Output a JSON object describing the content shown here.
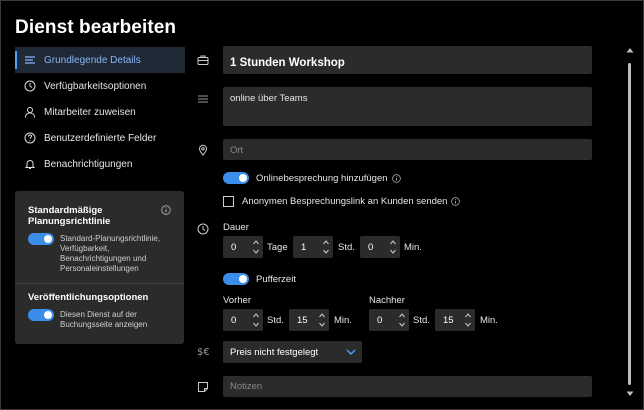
{
  "window": {
    "title": "Dienst bearbeiten"
  },
  "nav": {
    "items": [
      {
        "label": "Grundlegende Details",
        "active": true,
        "icon": "list-icon"
      },
      {
        "label": "Verfügbarkeitsoptionen",
        "active": false,
        "icon": "clock-icon"
      },
      {
        "label": "Mitarbeiter zuweisen",
        "active": false,
        "icon": "person-icon"
      },
      {
        "label": "Benutzerdefinierte Felder",
        "active": false,
        "icon": "question-icon"
      },
      {
        "label": "Benachrichtigungen",
        "active": false,
        "icon": "bell-icon"
      }
    ]
  },
  "panel": {
    "policy_heading": "Standardmäßige Planungsrichtlinie",
    "policy_desc": "Standard-Planungsrichtlinie, Verfügbarkeit, Benachrichtigungen und Personaleinstellungen",
    "policy_on": true,
    "publish_heading": "Veröffentlichungsoptionen",
    "publish_desc": "Diesen Dienst auf der Buchungsseite anzeigen",
    "publish_on": true
  },
  "form": {
    "service_name": "1 Stunden Workshop",
    "description": "online über Teams",
    "location_placeholder": "Ort",
    "online_meeting_label": "Onlinebesprechung hinzufügen",
    "online_meeting_on": true,
    "anon_link_label": "Anonymen Besprechungslink an Kunden senden",
    "anon_link_checked": false,
    "duration": {
      "label": "Dauer",
      "days": "0",
      "days_unit": "Tage",
      "hours": "1",
      "hours_unit": "Std.",
      "minutes": "0",
      "minutes_unit": "Min."
    },
    "buffer": {
      "label": "Pufferzeit",
      "on": true,
      "before_label": "Vorher",
      "before_hours": "0",
      "before_minutes": "15",
      "after_label": "Nachher",
      "after_hours": "0",
      "after_minutes": "15",
      "hours_unit": "Std.",
      "minutes_unit": "Min."
    },
    "price": {
      "value": "Preis nicht festgelegt"
    },
    "notes_placeholder": "Notizen"
  },
  "colors": {
    "accent": "#3a8eea",
    "field": "#2b2b2b",
    "active_nav": "#1f2a36"
  }
}
